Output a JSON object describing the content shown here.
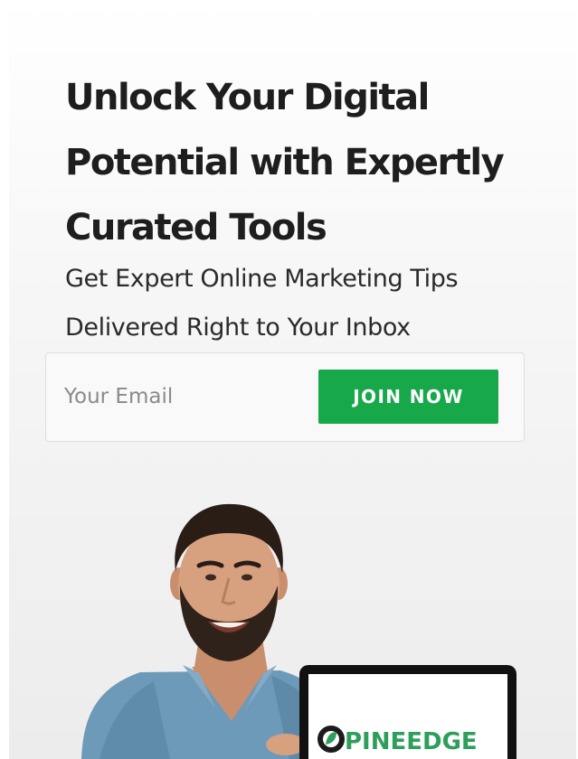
{
  "hero": {
    "headline_line1": "Unlock Your Digital",
    "headline_line2": "Potential with Expertly",
    "headline_line3": "Curated Tools",
    "subhead_line1": "Get Expert Online Marketing Tips",
    "subhead_line2": "Delivered Right to Your Inbox"
  },
  "signup": {
    "email_placeholder": "Your Email",
    "email_value": "",
    "join_label": "JOIN NOW"
  },
  "brand": {
    "logo_text": "PINEEDGE",
    "logo_icon": "leaf-circle-icon"
  },
  "colors": {
    "accent": "#17a84a",
    "headline": "#1e1e1e",
    "logo_green": "#2e9e5b"
  }
}
